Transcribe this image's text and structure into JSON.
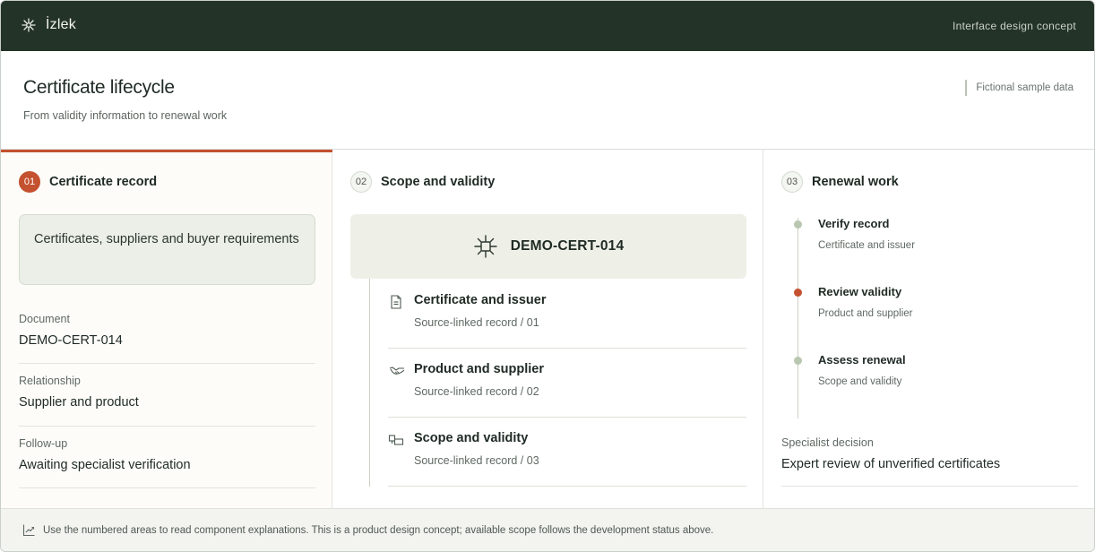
{
  "app": {
    "name": "İzlek",
    "note": "Interface design concept"
  },
  "header": {
    "title": "Certificate lifecycle",
    "subtitle": "From validity information to renewal work",
    "sample_note": "Fictional sample data"
  },
  "columns": [
    {
      "number": "01",
      "title": "Certificate record"
    },
    {
      "number": "02",
      "title": "Scope and validity"
    },
    {
      "number": "03",
      "title": "Renewal work"
    }
  ],
  "record": {
    "summary": "Certificates, suppliers and buyer requirements",
    "fields": [
      {
        "label": "Document",
        "value": "DEMO-CERT-014"
      },
      {
        "label": "Relationship",
        "value": "Supplier and product"
      },
      {
        "label": "Follow-up",
        "value": "Awaiting specialist verification"
      }
    ]
  },
  "scope": {
    "certificate_id": "DEMO-CERT-014",
    "items": [
      {
        "icon": "document-icon",
        "title": "Certificate and issuer",
        "subtitle": "Source-linked record / 01"
      },
      {
        "icon": "handshake-icon",
        "title": "Product and supplier",
        "subtitle": "Source-linked record / 02"
      },
      {
        "icon": "boxes-icon",
        "title": "Scope and validity",
        "subtitle": "Source-linked record / 03"
      }
    ]
  },
  "renewal": {
    "steps": [
      {
        "title": "Verify record",
        "subtitle": "Certificate and issuer",
        "status": "muted"
      },
      {
        "title": "Review validity",
        "subtitle": "Product and supplier",
        "status": "active"
      },
      {
        "title": "Assess renewal",
        "subtitle": "Scope and validity",
        "status": "muted"
      }
    ],
    "decision_label": "Specialist decision",
    "decision_value": "Expert review of unverified certificates"
  },
  "footer": {
    "icon": "trend-chart-icon",
    "text": "Use the numbered areas to read component explanations. This is a product design concept; available scope follows the development status above."
  },
  "colors": {
    "topbar": "#243328",
    "accent": "#c4512f",
    "muted_dot": "#b9c7b0",
    "panel_green": "#ebefe7"
  }
}
